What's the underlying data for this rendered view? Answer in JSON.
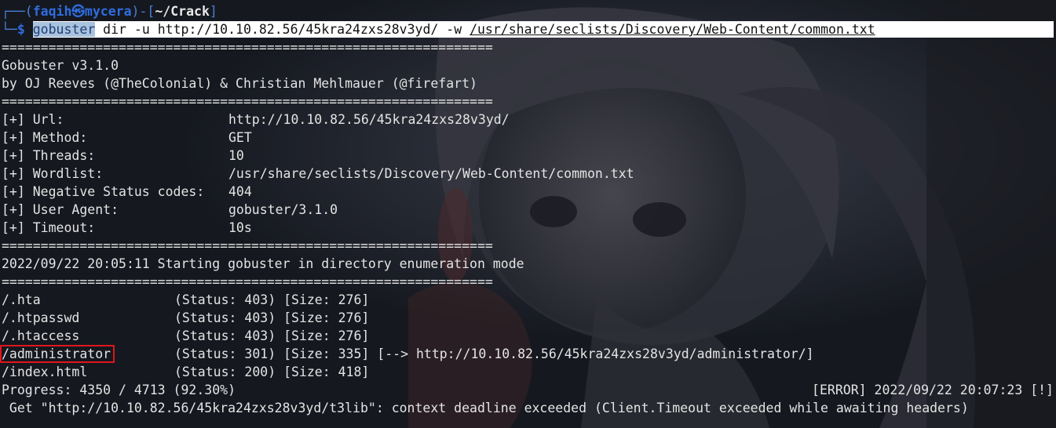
{
  "prompt": {
    "frame_top_left": "┌──(",
    "user_host": "faqih㉿mycera",
    "frame_mid": ")-[",
    "cwd": "~/Crack",
    "frame_end": "]",
    "frame_bottom": "└─",
    "dollar": "$"
  },
  "command": {
    "program": "gobuster",
    "args": " dir -u http://10.10.82.56/45kra24zxs28v3yd/ -w ",
    "wordlist": "/usr/share/seclists/Discovery/Web-Content/common.txt"
  },
  "separator": "===============================================================",
  "banner": {
    "version": "Gobuster v3.1.0",
    "authors": "by OJ Reeves (@TheColonial) & Christian Mehlmauer (@firefart)"
  },
  "config": [
    {
      "label": "[+] Url:",
      "value": "http://10.10.82.56/45kra24zxs28v3yd/"
    },
    {
      "label": "[+] Method:",
      "value": "GET"
    },
    {
      "label": "[+] Threads:",
      "value": "10"
    },
    {
      "label": "[+] Wordlist:",
      "value": "/usr/share/seclists/Discovery/Web-Content/common.txt"
    },
    {
      "label": "[+] Negative Status codes:",
      "value": "404"
    },
    {
      "label": "[+] User Agent:",
      "value": "gobuster/3.1.0"
    },
    {
      "label": "[+] Timeout:",
      "value": "10s"
    }
  ],
  "start_message": "2022/09/22 20:05:11 Starting gobuster in directory enumeration mode",
  "results": [
    {
      "path": "/.hta",
      "status": "(Status: 403) [Size: 276]"
    },
    {
      "path": "/.htpasswd",
      "status": "(Status: 403) [Size: 276]"
    },
    {
      "path": "/.htaccess",
      "status": "(Status: 403) [Size: 276]"
    },
    {
      "path": "/administrator",
      "status": "(Status: 301) [Size: 335] [--> http://10.10.82.56/45kra24zxs28v3yd/administrator/]"
    },
    {
      "path": "/index.html",
      "status": "(Status: 200) [Size: 418]"
    }
  ],
  "progress": {
    "text": "Progress: 4350 / 4713 (92.30%)",
    "error_tag": "[ERROR] 2022/09/22 20:07:23 [!]"
  },
  "error_detail": " Get \"http://10.10.82.56/45kra24zxs28v3yd/t3lib\": context deadline exceeded (Client.Timeout exceeded while awaiting headers)",
  "colors": {
    "background": "#15181f",
    "prompt_blue": "#2f6ddf",
    "highlight_red": "#e0161b",
    "command_bg": "#ffffff"
  }
}
